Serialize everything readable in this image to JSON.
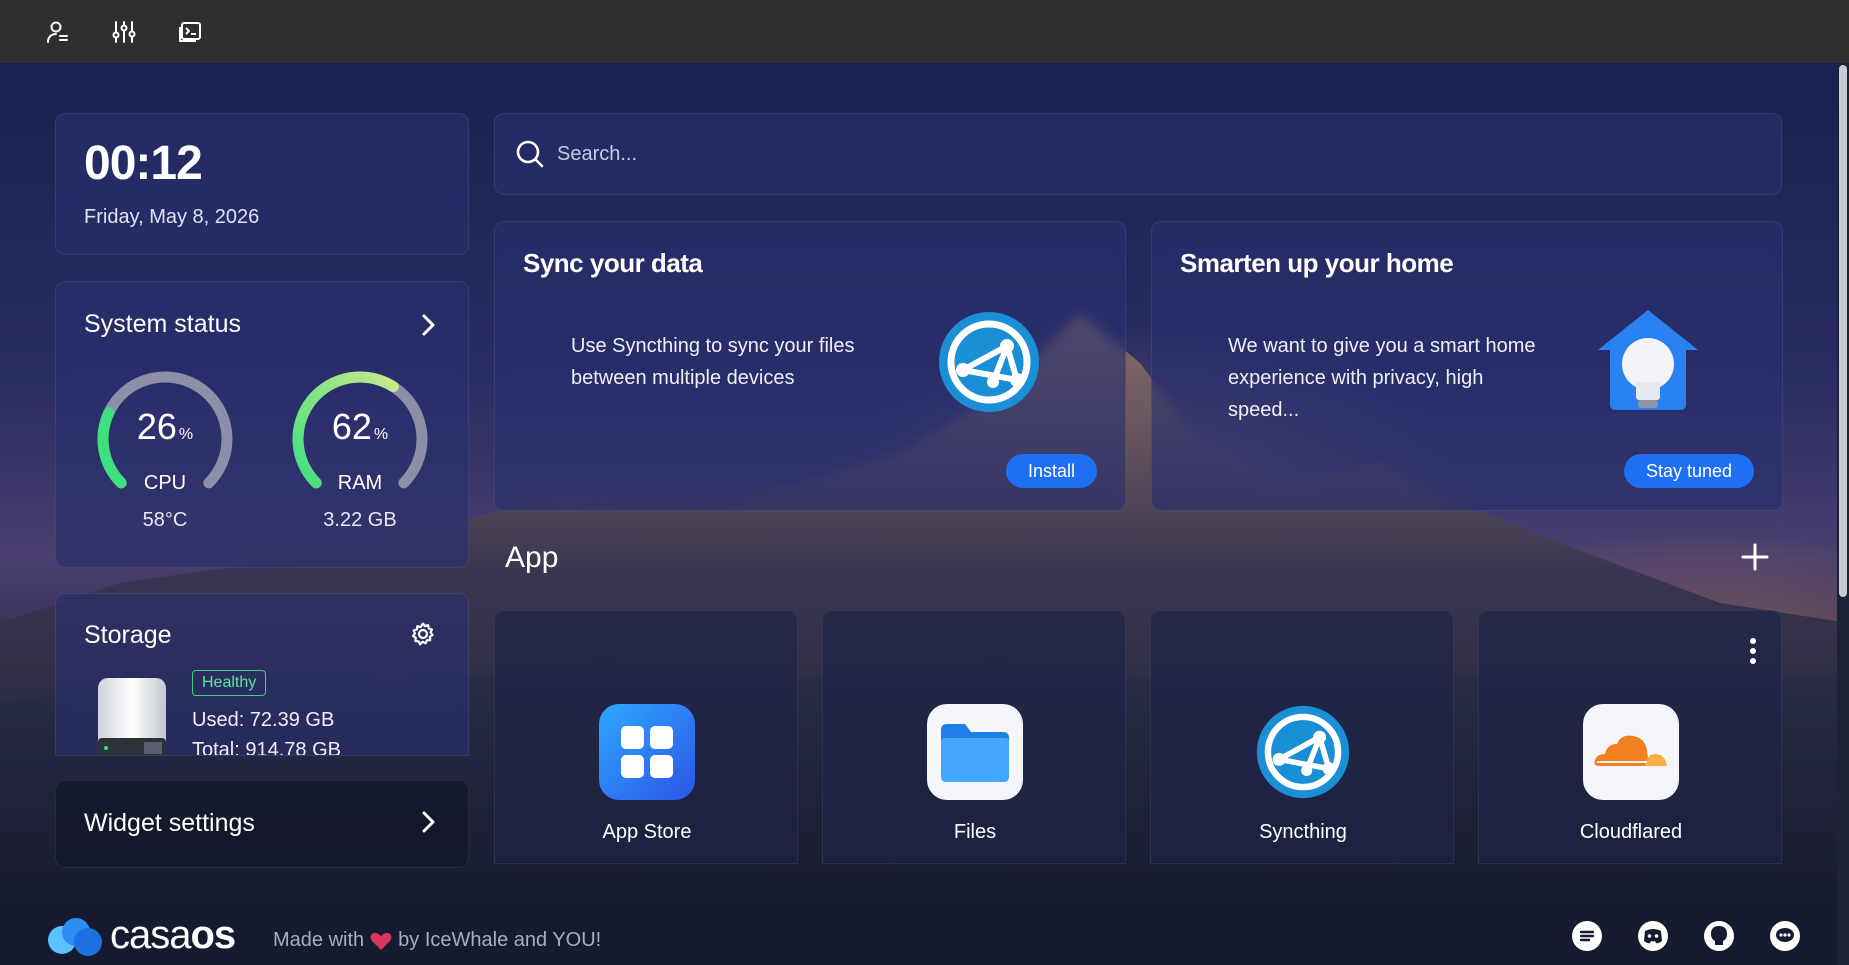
{
  "topbar": {
    "icons": [
      "user-settings-icon",
      "sliders-icon",
      "terminal-icon"
    ]
  },
  "clock": {
    "time": "00:12",
    "date": "Friday, May 8, 2026"
  },
  "system_status": {
    "title": "System status",
    "cpu": {
      "value": "26",
      "unit": "%",
      "label": "CPU",
      "sub": "58°C",
      "percent": 26
    },
    "ram": {
      "value": "62",
      "unit": "%",
      "label": "RAM",
      "sub": "3.22 GB",
      "percent": 62
    }
  },
  "storage": {
    "title": "Storage",
    "status": "Healthy",
    "used": "Used: 72.39 GB",
    "total": "Total: 914.78 GB"
  },
  "widget_settings": {
    "label": "Widget settings"
  },
  "search": {
    "placeholder": "Search..."
  },
  "promos": [
    {
      "title": "Sync your data",
      "text": "Use Syncthing to sync your files between multiple devices",
      "button": "Install",
      "icon": "syncthing-icon"
    },
    {
      "title": "Smarten up your home",
      "text": "We want to give you a smart home experience with privacy, high speed...",
      "button": "Stay tuned",
      "icon": "smart-home-bulb-icon"
    }
  ],
  "apps": {
    "heading": "App",
    "items": [
      {
        "name": "App Store",
        "icon": "app-store-icon"
      },
      {
        "name": "Files",
        "icon": "files-folder-icon"
      },
      {
        "name": "Syncthing",
        "icon": "syncthing-icon"
      },
      {
        "name": "Cloudflared",
        "icon": "cloudflare-icon"
      }
    ]
  },
  "footer": {
    "logo_light": "casa",
    "logo_bold": "os",
    "made_with_prefix": "Made with",
    "made_with_suffix": "by IceWhale and YOU!",
    "social_icons": [
      "feedback-icon",
      "discord-icon",
      "github-icon",
      "chat-icon"
    ]
  },
  "colors": {
    "accent": "#1f6ff2",
    "healthy": "#3fd08a",
    "gauge_green": "#3ee07f",
    "gauge_track": "#8d8fa8"
  }
}
